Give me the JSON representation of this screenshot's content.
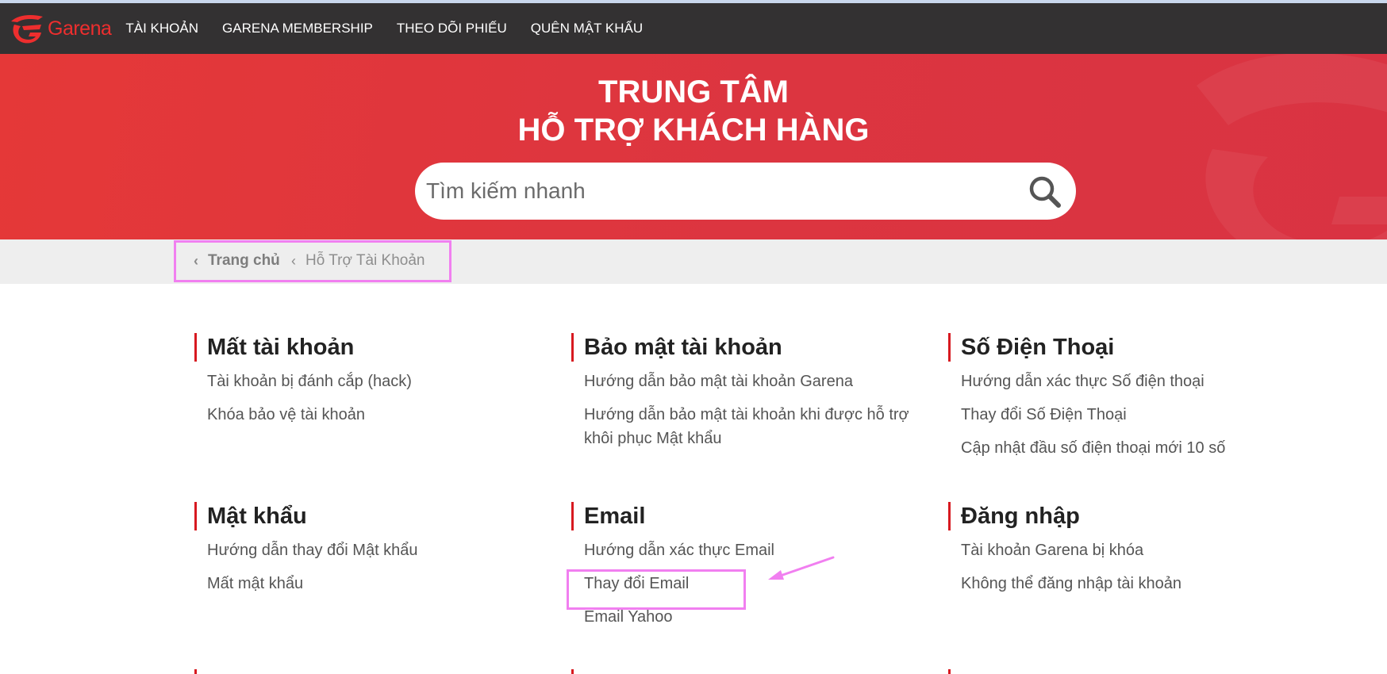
{
  "brand": {
    "logo_text": "Garena",
    "accent_color": "#ee2e2e",
    "logo_icon": "garena-dragon-icon"
  },
  "nav": {
    "items": [
      {
        "label": "TÀI KHOẢN"
      },
      {
        "label": "GARENA MEMBERSHIP"
      },
      {
        "label": "THEO DÕI PHIẾU"
      },
      {
        "label": "QUÊN MẬT KHẨU"
      }
    ]
  },
  "hero": {
    "title_line1": "TRUNG TÂM",
    "title_line2": "HỖ TRỢ KHÁCH HÀNG",
    "background_color": "#e03a3e"
  },
  "search": {
    "placeholder": "Tìm kiếm nhanh",
    "icon": "search-icon"
  },
  "breadcrumb": {
    "home": "Trang chủ",
    "current": "Hỗ Trợ Tài Khoản",
    "separator_icon": "chevron-left-icon"
  },
  "sections": [
    {
      "title": "Mất tài khoản",
      "links": [
        "Tài khoản bị đánh cắp (hack)",
        "Khóa bảo vệ tài khoản"
      ]
    },
    {
      "title": "Bảo mật tài khoản",
      "links": [
        "Hướng dẫn bảo mật tài khoản Garena",
        "Hướng dẫn bảo mật tài khoản khi được hỗ trợ khôi phục Mật khẩu"
      ]
    },
    {
      "title": "Số Điện Thoại",
      "links": [
        "Hướng dẫn xác thực Số điện thoại",
        "Thay đổi Số Điện Thoại",
        "Cập nhật đầu số điện thoại mới 10 số"
      ]
    },
    {
      "title": "Mật khẩu",
      "links": [
        "Hướng dẫn thay đổi Mật khẩu",
        "Mất mật khẩu"
      ]
    },
    {
      "title": "Email",
      "links": [
        "Hướng dẫn xác thực Email",
        "Thay đổi Email",
        "Email Yahoo"
      ]
    },
    {
      "title": "Đăng nhập",
      "links": [
        "Tài khoản Garena bị khóa",
        "Không thể đăng nhập tài khoản"
      ]
    }
  ],
  "annotations": {
    "highlight_color": "#f17ff0"
  }
}
